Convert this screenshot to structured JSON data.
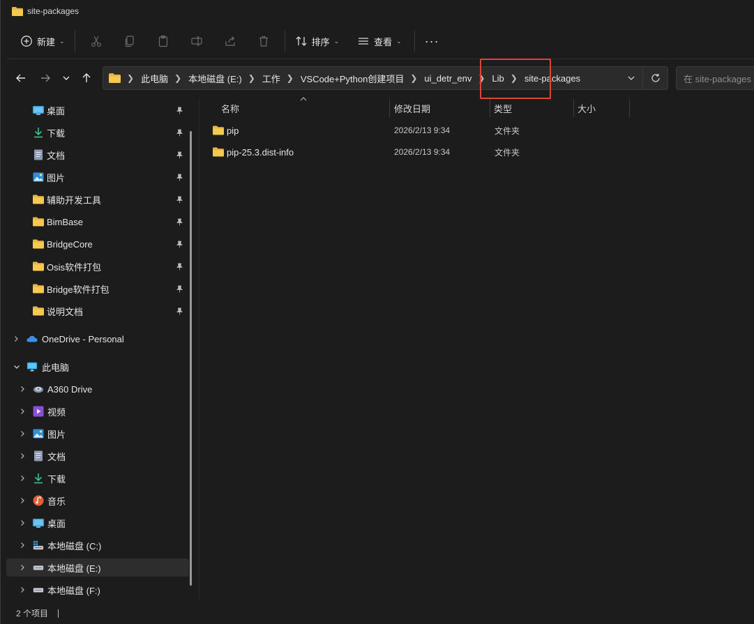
{
  "window": {
    "title": "site-packages"
  },
  "toolbar": {
    "new_label": "新建",
    "sort_label": "排序",
    "view_label": "查看",
    "more_label": "···"
  },
  "address": {
    "crumbs": [
      "此电脑",
      "本地磁盘 (E:)",
      "工作",
      "VSCode+Python创建项目",
      "ui_detr_env",
      "Lib",
      "site-packages"
    ]
  },
  "search": {
    "placeholder": "在 site-packages 中搜索"
  },
  "sidebar": {
    "quick_access": [
      {
        "label": "桌面",
        "icon": "desktop-icon"
      },
      {
        "label": "下载",
        "icon": "download-icon"
      },
      {
        "label": "文档",
        "icon": "document-icon"
      },
      {
        "label": "图片",
        "icon": "pictures-icon"
      },
      {
        "label": "辅助开发工具",
        "icon": "folder-icon"
      },
      {
        "label": "BimBase",
        "icon": "folder-icon"
      },
      {
        "label": "BridgeCore",
        "icon": "folder-icon"
      },
      {
        "label": "Osis软件打包",
        "icon": "folder-icon"
      },
      {
        "label": "Bridge软件打包",
        "icon": "folder-icon"
      },
      {
        "label": "说明文档",
        "icon": "folder-icon"
      }
    ],
    "onedrive_label": "OneDrive - Personal",
    "thispc_label": "此电脑",
    "thispc_items": [
      {
        "label": "A360 Drive",
        "icon": "cloud-drive-icon"
      },
      {
        "label": "视频",
        "icon": "video-icon"
      },
      {
        "label": "图片",
        "icon": "pictures-icon"
      },
      {
        "label": "文档",
        "icon": "document-icon"
      },
      {
        "label": "下载",
        "icon": "download-icon"
      },
      {
        "label": "音乐",
        "icon": "music-icon"
      },
      {
        "label": "桌面",
        "icon": "desktop-icon"
      },
      {
        "label": "本地磁盘 (C:)",
        "icon": "system-drive-icon"
      },
      {
        "label": "本地磁盘 (E:)",
        "icon": "drive-icon",
        "selected": true
      },
      {
        "label": "本地磁盘 (F:)",
        "icon": "drive-icon"
      }
    ]
  },
  "columns": {
    "name": "名称",
    "date": "修改日期",
    "type": "类型",
    "size": "大小"
  },
  "files": [
    {
      "name": "pip",
      "date": "2026/2/13 9:34",
      "type": "文件夹",
      "size": ""
    },
    {
      "name": "pip-25.3.dist-info",
      "date": "2026/2/13 9:34",
      "type": "文件夹",
      "size": ""
    }
  ],
  "status": {
    "item_count": "2 个项目"
  },
  "colors": {
    "background": "#1c1c1c",
    "folder": "#e8b73e",
    "highlight": "#e0453a"
  }
}
